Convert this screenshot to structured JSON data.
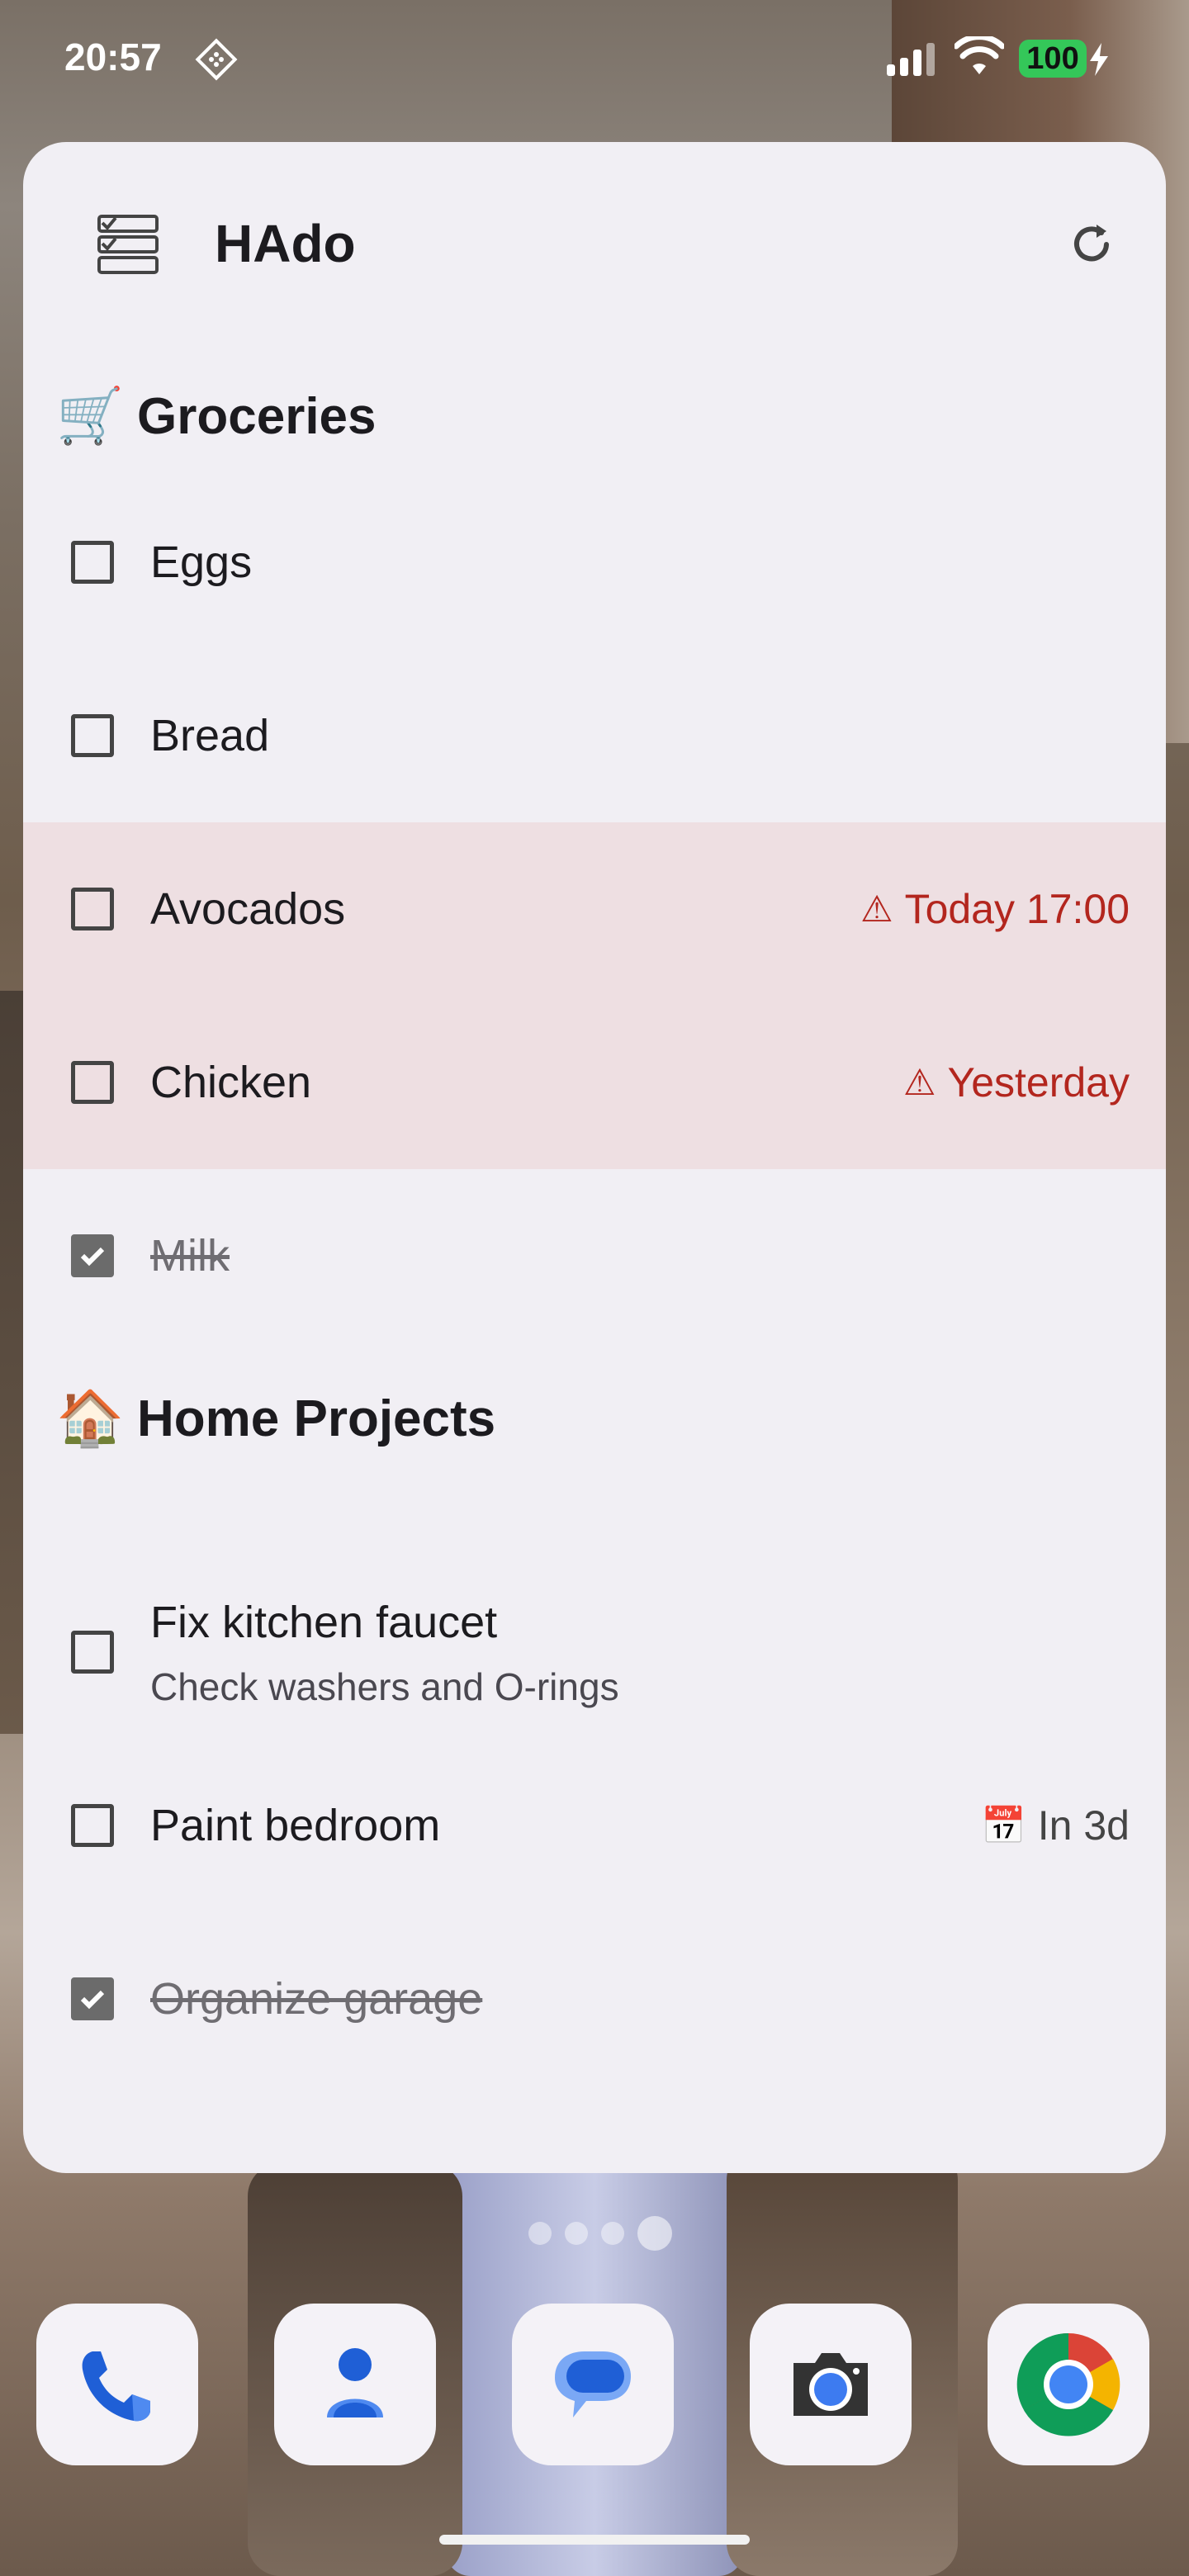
{
  "status_bar": {
    "time": "20:57",
    "battery": "100",
    "icons": [
      "diamond-icon",
      "signal-icon",
      "wifi-icon",
      "battery-charging-icon"
    ]
  },
  "widget": {
    "title": "HAdo",
    "app_icon": "checklist-icon",
    "refresh_icon": "refresh-icon",
    "lists": [
      {
        "emoji": "🛒",
        "name": "Groceries",
        "items": [
          {
            "label": "Eggs",
            "checked": false,
            "due": "",
            "overdue": false
          },
          {
            "label": "Bread",
            "checked": false,
            "due": "",
            "overdue": false
          },
          {
            "label": "Avocados",
            "checked": false,
            "due": "Today 17:00",
            "due_icon": "⚠",
            "overdue": true
          },
          {
            "label": "Chicken",
            "checked": false,
            "due": "Yesterday",
            "due_icon": "⚠",
            "overdue": true
          },
          {
            "label": "Milk",
            "checked": true,
            "due": "",
            "overdue": false
          }
        ]
      },
      {
        "emoji": "🏠",
        "name": "Home Projects",
        "items": [
          {
            "label": "Fix kitchen faucet",
            "note": "Check washers and O-rings",
            "checked": false
          },
          {
            "label": "Paint bedroom",
            "checked": false,
            "due": "In 3d",
            "due_icon": "📅"
          },
          {
            "label": "Organize garage",
            "checked": true
          }
        ]
      }
    ]
  },
  "dock": {
    "apps": [
      "phone-icon",
      "contacts-icon",
      "messages-icon",
      "camera-icon",
      "chrome-icon"
    ]
  },
  "colors": {
    "card_bg": "#f1eff4",
    "overdue_bg": "#eedfe2",
    "overdue_text": "#b3261e",
    "battery": "#34c759"
  }
}
